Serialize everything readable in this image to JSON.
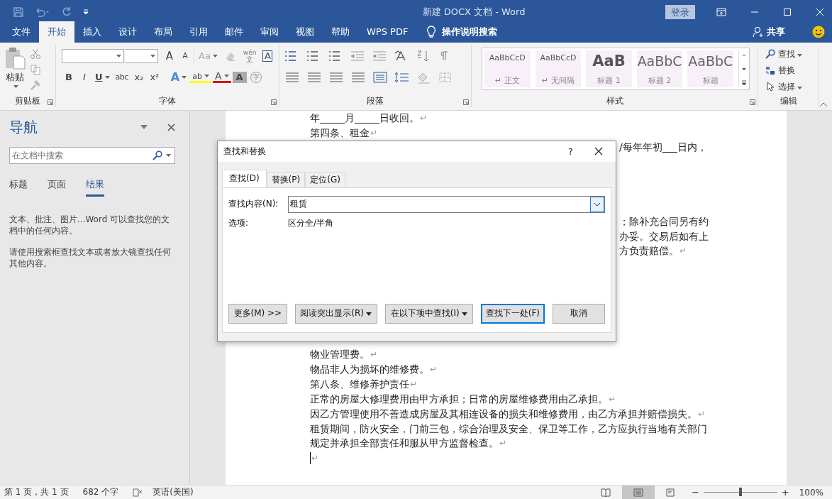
{
  "title_bar": {
    "title": "新建 DOCX 文档  -  Word",
    "login": "登录"
  },
  "tabs": [
    {
      "label": "文件",
      "selected": false
    },
    {
      "label": "开始",
      "selected": true
    },
    {
      "label": "插入",
      "selected": false
    },
    {
      "label": "设计",
      "selected": false
    },
    {
      "label": "布局",
      "selected": false
    },
    {
      "label": "引用",
      "selected": false
    },
    {
      "label": "邮件",
      "selected": false
    },
    {
      "label": "审阅",
      "selected": false
    },
    {
      "label": "视图",
      "selected": false
    },
    {
      "label": "帮助",
      "selected": false
    },
    {
      "label": "WPS PDF",
      "selected": false
    }
  ],
  "tell_me": "操作说明搜索",
  "share": "共享",
  "ribbon": {
    "clipboard": {
      "paste": "粘贴",
      "label": "剪贴板"
    },
    "font": {
      "label": "字体",
      "row1": [
        {
          "label": "A",
          "kind": "grow",
          "dropdown": false
        },
        {
          "label": "A",
          "kind": "shrink",
          "dropdown": false
        },
        {
          "label": "Aa",
          "kind": "case",
          "dropdown": true
        },
        {
          "kind": "clear",
          "dropdown": false
        },
        {
          "ruby": "wén",
          "label": "文",
          "kind": "phonetic",
          "dropdown": false
        },
        {
          "label": "A",
          "kind": "border",
          "dropdown": false
        }
      ],
      "row2": [
        {
          "label": "B",
          "kind": "bold",
          "dropdown": false
        },
        {
          "label": "I",
          "kind": "italic",
          "dropdown": false
        },
        {
          "label": "U",
          "kind": "underline",
          "dropdown": true
        },
        {
          "label": "abc",
          "kind": "strike",
          "dropdown": false
        },
        {
          "label": "x₂",
          "kind": "sub",
          "dropdown": false
        },
        {
          "label": "x²",
          "kind": "sup",
          "dropdown": false
        },
        {
          "label": "A",
          "kind": "effects",
          "dropdown": true
        },
        {
          "label": "ab",
          "kind": "highlight",
          "dropdown": true
        },
        {
          "label": "A",
          "kind": "color",
          "dropdown": true
        },
        {
          "label": "A",
          "kind": "shade",
          "dropdown": false
        },
        {
          "label": "字",
          "kind": "enclose",
          "dropdown": false
        }
      ]
    },
    "paragraph": {
      "label": "段落"
    },
    "styles": {
      "label": "样式",
      "items": [
        {
          "preview": "AaBbCcD",
          "name": "↵ 正文",
          "kind": "normal"
        },
        {
          "preview": "AaBbCcD",
          "name": "↵ 无间隔",
          "kind": "normal"
        },
        {
          "preview": "AaB",
          "name": "标题 1",
          "kind": "heading1"
        },
        {
          "preview": "AaBbC",
          "name": "标题 2",
          "kind": "heading2"
        },
        {
          "preview": "AaBbC",
          "name": "标题",
          "kind": "heading2"
        }
      ]
    },
    "editing": {
      "label": "编辑",
      "items": [
        {
          "label": "查找",
          "kind": "find",
          "dropdown": true
        },
        {
          "label": "替换",
          "kind": "replace",
          "dropdown": false
        },
        {
          "label": "选择",
          "kind": "select",
          "dropdown": true
        }
      ]
    }
  },
  "nav": {
    "title": "导航",
    "search_placeholder": "在文档中搜索",
    "tabs": [
      {
        "label": "标题",
        "selected": false
      },
      {
        "label": "页面",
        "selected": false
      },
      {
        "label": "结果",
        "selected": true
      }
    ],
    "paragraphs": [
      "文本、批注、图片...Word 可以查找您的文档中的任何内容。",
      "请使用搜索框查找文本或者放大镜查找任何其他内容。"
    ]
  },
  "document": {
    "rows": [
      {
        "kind": "text",
        "text": "年_____月_____日收回。",
        "para_mark": "↵"
      },
      {
        "kind": "text",
        "text": "第四条、租金",
        "para_mark": "↵"
      },
      {
        "kind": "fragment",
        "text": "/每年年初___日内，"
      },
      {
        "kind": "blank"
      },
      {
        "kind": "blank"
      },
      {
        "kind": "blank"
      },
      {
        "kind": "blank"
      },
      {
        "kind": "fragment",
        "text": "；除补充合同另有约"
      },
      {
        "kind": "fragment",
        "text": "办妥。交易后如有上"
      },
      {
        "kind": "fragment",
        "text": "方负责赔偿。",
        "para_mark": "↵"
      },
      {
        "kind": "blank"
      },
      {
        "kind": "blank"
      },
      {
        "kind": "blank"
      },
      {
        "kind": "blank"
      },
      {
        "kind": "blank"
      },
      {
        "kind": "blank"
      },
      {
        "kind": "text",
        "text": "物业管理费。",
        "para_mark": "↵"
      },
      {
        "kind": "text",
        "text": "物品非人为损坏的维修费。",
        "para_mark": "↵"
      },
      {
        "kind": "text",
        "text": "第八条、维修养护责任",
        "para_mark": "↵"
      },
      {
        "kind": "text",
        "text": "正常的房屋大修理费用由甲方承担；日常的房屋维修费用由乙承担。",
        "para_mark": "↵"
      },
      {
        "kind": "text",
        "text": "因乙方管理使用不善造成房屋及其相连设备的损失和维修费用，由乙方承担并赔偿损失。",
        "para_mark": "↵"
      },
      {
        "kind": "text",
        "text": "租赁期间，防火安全，门前三包，综合治理及安全、保卫等工作，乙方应执行当地有关部门"
      },
      {
        "kind": "text",
        "text": "规定并承担全部责任和服从甲方监督检查。",
        "para_mark": "↵"
      },
      {
        "kind": "cursor",
        "para_mark": "↵"
      }
    ]
  },
  "dialog": {
    "title": "查找和替换",
    "help": "?",
    "tabs": [
      {
        "label": "查找(D)",
        "selected": true
      },
      {
        "label": "替换(P)",
        "selected": false
      },
      {
        "label": "定位(G)",
        "selected": false
      }
    ],
    "find_label": "查找内容(N):",
    "find_value": "租赁",
    "options_label": "选项:",
    "options_value": "区分全/半角",
    "buttons": [
      {
        "label": "更多(M) >>",
        "dropdown": false,
        "default": false
      },
      {
        "label": "阅读突出显示(R)",
        "dropdown": true,
        "default": false
      },
      {
        "label": "在以下项中查找(I)",
        "dropdown": true,
        "default": false
      },
      {
        "label": "查找下一处(F)",
        "dropdown": false,
        "default": true
      },
      {
        "label": "取消",
        "dropdown": false,
        "default": false
      }
    ]
  },
  "status_bar": {
    "page": "第 1 页，共 1 页",
    "words": "682 个字",
    "language": "英语(美国)",
    "views": [
      {
        "kind": "read",
        "selected": false
      },
      {
        "kind": "print",
        "selected": true
      },
      {
        "kind": "web",
        "selected": false
      }
    ],
    "zoom_out": "−",
    "zoom_in": "+",
    "zoom_slider": {
      "level": 0.5
    },
    "zoom": "100%"
  }
}
